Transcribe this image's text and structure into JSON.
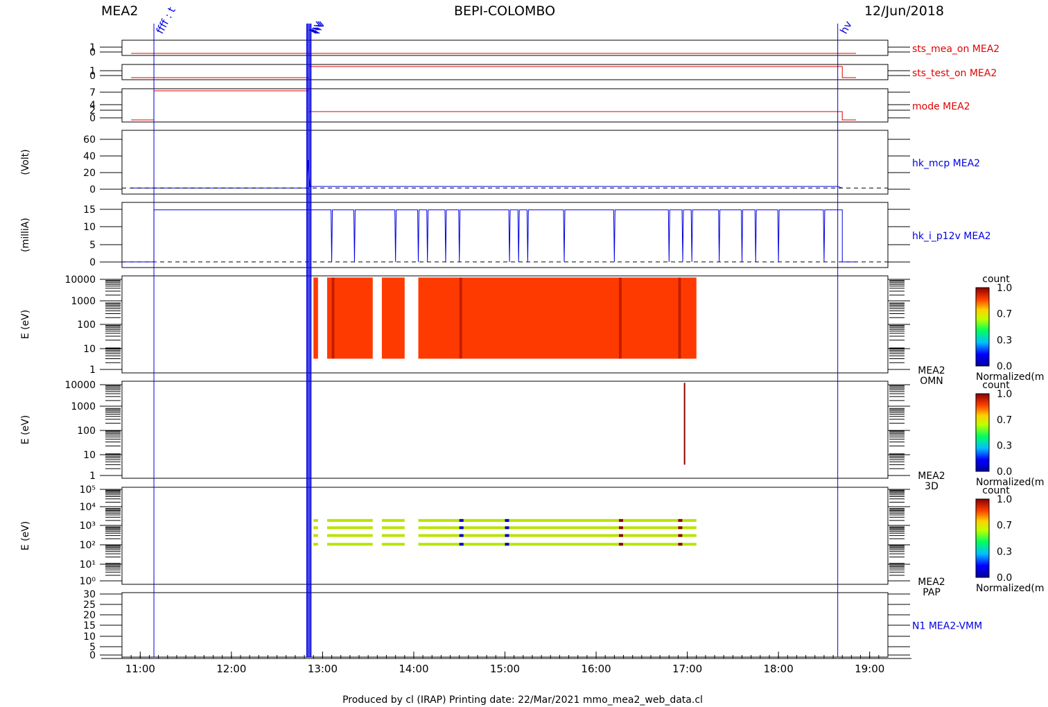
{
  "header": {
    "left": "MEA2",
    "center": "BEPI-COLOMBO",
    "right": "12/Jun/2018"
  },
  "footer": "Produced by cl (IRAP)   Printing date: 22/Mar/2021   mmo_mea2_web_data.cl",
  "colors": {
    "red": "#e00000",
    "blue": "#0000e0",
    "spec": "#ff3a00",
    "darkred": "#8b0000",
    "frame": "#000000"
  },
  "time_axis": {
    "start_h": 10.8,
    "end_h": 19.2,
    "ticks": [
      "11:00",
      "12:00",
      "13:00",
      "14:00",
      "15:00",
      "16:00",
      "17:00",
      "18:00",
      "19:00"
    ]
  },
  "event_markers": [
    {
      "label": "ffff : t",
      "t": 11.15
    },
    {
      "label": "hv",
      "t": 12.83
    },
    {
      "label": "hv",
      "t": 12.85
    },
    {
      "label": "hv",
      "t": 12.87
    },
    {
      "label": "hv",
      "t": 18.65
    }
  ],
  "colorbar": {
    "title": "count",
    "ticks": [
      "1.0",
      "0.7",
      "0.3",
      "0.0"
    ],
    "caption": "Normalized(m"
  },
  "chart_data": [
    {
      "type": "line",
      "name": "sts_mea_on MEA2",
      "yticks": [
        "1",
        "0"
      ],
      "ylim": [
        0,
        1
      ],
      "segments": [
        [
          10.9,
          0
        ],
        [
          18.85,
          0
        ]
      ]
    },
    {
      "type": "line",
      "name": "sts_test_on MEA2",
      "yticks": [
        "1",
        "0"
      ],
      "ylim": [
        0,
        1
      ],
      "segments": [
        [
          10.9,
          0
        ],
        [
          12.85,
          0
        ],
        [
          12.85,
          1
        ],
        [
          18.7,
          1
        ],
        [
          18.7,
          0
        ],
        [
          18.85,
          0
        ]
      ]
    },
    {
      "type": "line",
      "name": "mode MEA2",
      "yticks": [
        "7",
        "4",
        "2",
        "0"
      ],
      "ylim": [
        0,
        7
      ],
      "segments": [
        [
          10.9,
          0
        ],
        [
          11.15,
          0
        ],
        [
          11.15,
          7
        ],
        [
          12.85,
          7
        ],
        [
          12.85,
          2
        ],
        [
          18.7,
          2
        ],
        [
          18.7,
          0
        ],
        [
          18.85,
          0
        ]
      ]
    },
    {
      "type": "line",
      "name": "hk_mcp MEA2",
      "ylabel": "(Volt)",
      "yticks": [
        "60",
        "40",
        "20",
        "0"
      ],
      "ylim": [
        -5,
        70
      ],
      "segments": [
        [
          10.9,
          0
        ],
        [
          12.83,
          0
        ],
        [
          12.84,
          35
        ],
        [
          12.86,
          2
        ],
        [
          18.65,
          2
        ],
        [
          18.7,
          0
        ]
      ]
    },
    {
      "type": "line",
      "name": "hk_i_p12v MEA2",
      "ylabel": "(milliA)",
      "yticks": [
        "15",
        "10",
        "5",
        "0"
      ],
      "ylim": [
        -1,
        16
      ],
      "base_on": 14.5,
      "on_start": 11.15,
      "on_end": 18.7,
      "dropouts": [
        13.1,
        13.35,
        13.8,
        14.05,
        14.15,
        14.35,
        14.5,
        15.05,
        15.15,
        15.25,
        15.65,
        16.2,
        16.8,
        16.95,
        17.05,
        17.35,
        17.6,
        17.75,
        18.0,
        18.5
      ]
    },
    {
      "type": "heatmap",
      "name": "MEA2 OMN",
      "ylabel": "E (eV)",
      "yticks": [
        "10000",
        "1000",
        "100",
        "10",
        "1"
      ],
      "blocks": [
        [
          12.9,
          12.95
        ],
        [
          13.05,
          13.55
        ],
        [
          13.65,
          13.9
        ],
        [
          14.05,
          17.1
        ]
      ],
      "erange": [
        3,
        12000
      ]
    },
    {
      "type": "heatmap",
      "name": "MEA2 3D",
      "ylabel": "E (eV)",
      "yticks": [
        "10000",
        "1000",
        "100",
        "10",
        "1"
      ],
      "spikes": [
        {
          "t": 16.97,
          "emin": 3,
          "emax": 12000
        }
      ]
    },
    {
      "type": "heatmap",
      "name": "MEA2 PAP",
      "ylabel": "E (eV)",
      "yticks": [
        "10⁵",
        "10⁴",
        "10³",
        "10²",
        "10¹",
        "10⁰"
      ],
      "blocks": [
        [
          12.9,
          12.95
        ],
        [
          13.05,
          13.55
        ],
        [
          13.65,
          13.9
        ],
        [
          14.05,
          17.1
        ]
      ],
      "energies": [
        2000,
        800,
        300,
        100
      ]
    },
    {
      "type": "line",
      "name": "N1 MEA2-VMM",
      "yticks": [
        "30",
        "25",
        "20",
        "15",
        "10",
        "5",
        "0"
      ],
      "ylim": [
        0,
        30
      ],
      "segments": []
    }
  ]
}
